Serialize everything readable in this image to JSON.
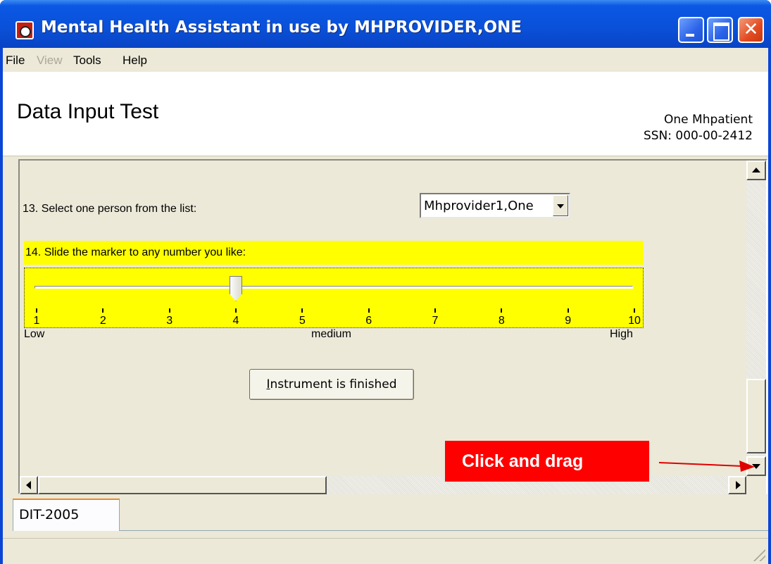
{
  "window": {
    "title": "Mental Health Assistant in use by MHPROVIDER,ONE",
    "close_glyph": "✕"
  },
  "menu": {
    "items": [
      {
        "label": "File",
        "enabled": true
      },
      {
        "label": "View",
        "enabled": false
      },
      {
        "label": "Tools",
        "enabled": true
      },
      {
        "label": "Help",
        "enabled": true
      }
    ]
  },
  "header": {
    "title": "Data Input Test",
    "patient_name": "One Mhpatient",
    "patient_ssn": "SSN: 000-00-2412"
  },
  "question13": {
    "label": "13. Select one person from the list:",
    "selected_value": "Mhprovider1,One"
  },
  "question14": {
    "label": "14. Slide the marker to any number you like:",
    "slider_value": 4,
    "slider_min": 1,
    "slider_max": 10,
    "ticks": [
      "1",
      "2",
      "3",
      "4",
      "5",
      "6",
      "7",
      "8",
      "9",
      "10"
    ],
    "scale_low": "Low",
    "scale_mid": "medium",
    "scale_high": "High",
    "highlight_color": "#ffff00"
  },
  "finish_button": {
    "mnemonic": "I",
    "rest": "nstrument is finished"
  },
  "annotation": {
    "text": "Click and drag",
    "color": "#ff0000"
  },
  "tabs": [
    {
      "label": "DIT-2005",
      "active": true
    }
  ]
}
